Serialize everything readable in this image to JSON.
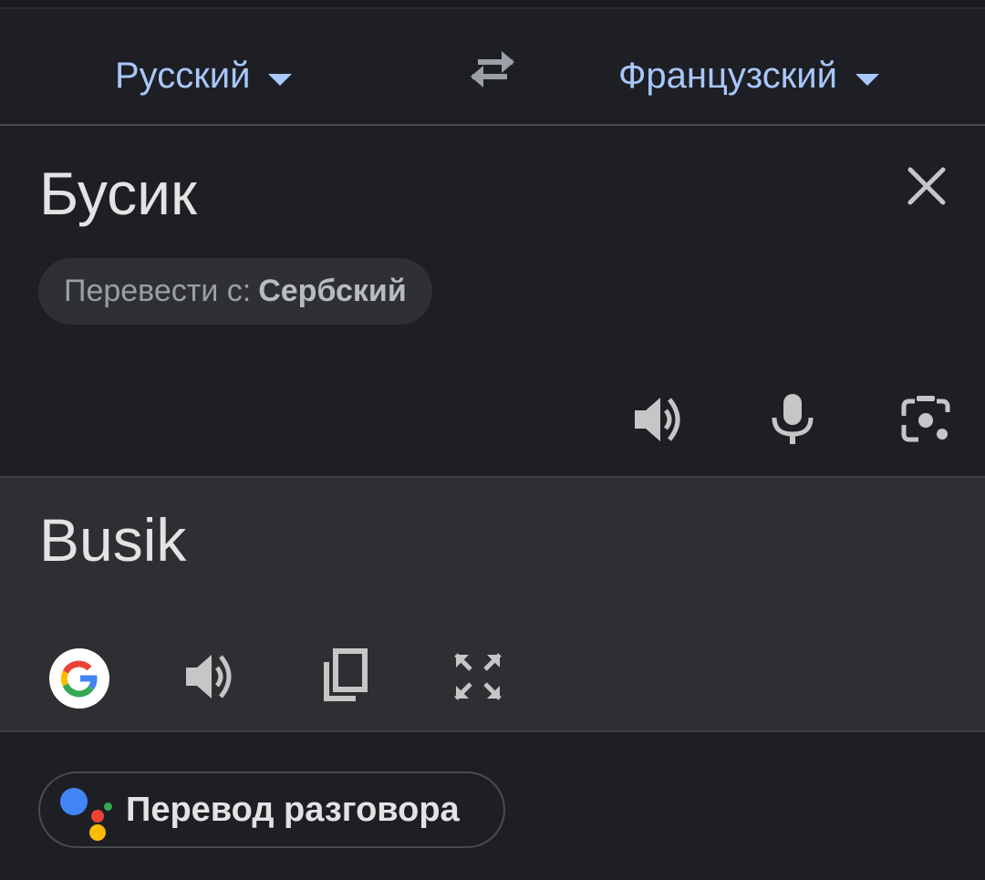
{
  "language_bar": {
    "source_language": "Русский",
    "target_language": "Французский",
    "swap_icon": "swap-arrows-icon",
    "caret_icon": "caret-down-icon"
  },
  "source": {
    "text": "Бусик",
    "clear_icon": "close-icon",
    "detect_prefix": "Перевести с:",
    "detect_language": "Сербский",
    "actions": [
      "speaker-icon",
      "microphone-icon",
      "camera-lens-icon"
    ]
  },
  "translation": {
    "text": "Busik",
    "actions": [
      "google-icon",
      "speaker-icon",
      "copy-icon",
      "fullscreen-icon"
    ]
  },
  "conversation": {
    "label": "Перевод разговора",
    "icon": "google-assistant-icon"
  },
  "colors": {
    "accent": "#a8c7fa",
    "background": "#1e1f24",
    "translation_background": "#2e2f33",
    "icon_gray": "#c4c7c5",
    "google_blue": "#4285f4",
    "google_red": "#ea4335",
    "google_yellow": "#fbbc04",
    "google_green": "#34a853"
  }
}
